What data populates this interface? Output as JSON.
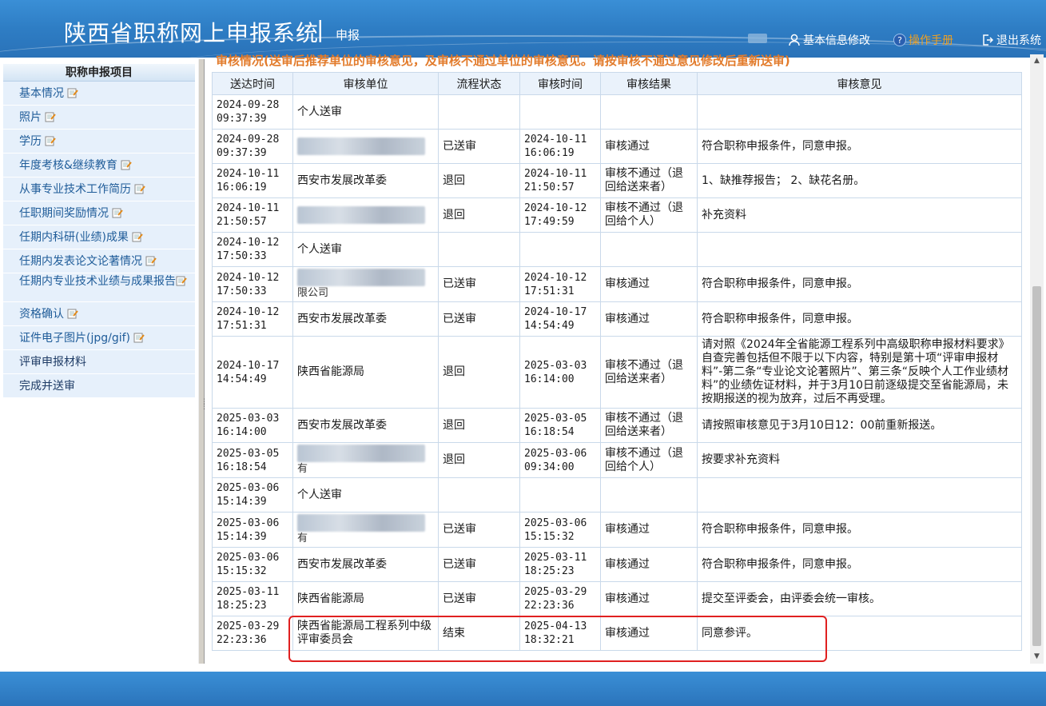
{
  "header": {
    "title": "陕西省职称网上申报系统",
    "separator": "|",
    "subtitle": "申报",
    "links": {
      "info": "基本信息修改",
      "manual": "操作手册",
      "exit": "退出系统"
    },
    "colors": {
      "bar": "#2e7dc4",
      "manual": "#f0a020"
    }
  },
  "sidebar": {
    "heading": "职称申报项目",
    "items": [
      {
        "label": "基本情况",
        "icon": "edit-icon"
      },
      {
        "label": "照片",
        "icon": "edit-icon"
      },
      {
        "label": "学历",
        "icon": "edit-icon"
      },
      {
        "label": "年度考核&继续教育",
        "icon": "edit-icon"
      },
      {
        "label": "从事专业技术工作简历",
        "icon": "edit-icon"
      },
      {
        "label": "任职期间奖励情况",
        "icon": "edit-icon"
      },
      {
        "label": "任期内科研(业绩)成果",
        "icon": "edit-icon"
      },
      {
        "label": "任期内发表论文论著情况",
        "icon": "edit-icon"
      },
      {
        "label": "任期内专业技术业绩与成果报告",
        "icon": "edit-icon"
      },
      {
        "label": "资格确认",
        "icon": "edit-icon"
      },
      {
        "label": "证件电子图片(jpg/gif)",
        "icon": "edit-icon"
      },
      {
        "label": "评审申报材料"
      },
      {
        "label": "完成并送审"
      }
    ]
  },
  "main": {
    "heading": "审核情况(送审后推荐单位的审核意见，及审核不通过单位的审核意见。请按审核不通过意见修改后重新送审)",
    "columns": [
      "送达时间",
      "审核单位",
      "流程状态",
      "审核时间",
      "审核结果",
      "审核意见"
    ],
    "rows": [
      {
        "sent": "2024-09-28 09:37:39",
        "unit": "个人送审",
        "status": "",
        "time": "",
        "result": "",
        "opinion": ""
      },
      {
        "sent": "2024-09-28 09:37:39",
        "unit": "",
        "unit_tail": "",
        "status": "已送审",
        "time": "2024-10-11 16:06:19",
        "result": "审核通过",
        "opinion": "符合职称申报条件，同意申报。"
      },
      {
        "sent": "2024-10-11 16:06:19",
        "unit": "西安市发展改革委",
        "status": "退回",
        "time": "2024-10-11 21:50:57",
        "result": "审核不通过（退回给送来者）",
        "opinion": "1、缺推荐报告； 2、缺花名册。"
      },
      {
        "sent": "2024-10-11 21:50:57",
        "unit": "",
        "unit_tail": "",
        "status": "退回",
        "time": "2024-10-12 17:49:59",
        "result": "审核不通过（退回给个人）",
        "opinion": "补充资料"
      },
      {
        "sent": "2024-10-12 17:50:33",
        "unit": "个人送审",
        "status": "",
        "time": "",
        "result": "",
        "opinion": ""
      },
      {
        "sent": "2024-10-12 17:50:33",
        "unit": "",
        "unit_tail": "限公司",
        "status": "已送审",
        "time": "2024-10-12 17:51:31",
        "result": "审核通过",
        "opinion": "符合职称申报条件，同意申报。"
      },
      {
        "sent": "2024-10-12 17:51:31",
        "unit": "西安市发展改革委",
        "status": "已送审",
        "time": "2024-10-17 14:54:49",
        "result": "审核通过",
        "opinion": "符合职称申报条件，同意申报。"
      },
      {
        "sent": "2024-10-17 14:54:49",
        "unit": "陕西省能源局",
        "status": "退回",
        "time": "2025-03-03 16:14:00",
        "result": "审核不通过（退回给送来者）",
        "opinion": "请对照《2024年全省能源工程系列中高级职称申报材料要求》自查完善包括但不限于以下内容，特别是第十项“评审申报材料”-第二条“专业论文论著照片”、第三条“反映个人工作业绩材料”的业绩佐证材料，并于3月10日前逐级提交至省能源局，未按期报送的视为放弃，过后不再受理。"
      },
      {
        "sent": "2025-03-03 16:14:00",
        "unit": "西安市发展改革委",
        "status": "退回",
        "time": "2025-03-05 16:18:54",
        "result": "审核不通过（退回给送来者）",
        "opinion": "请按照审核意见于3月10日12：00前重新报送。"
      },
      {
        "sent": "2025-03-05 16:18:54",
        "unit": "",
        "unit_tail": "有",
        "status": "退回",
        "time": "2025-03-06 09:34:00",
        "result": "审核不通过（退回给个人）",
        "opinion": "按要求补充资料"
      },
      {
        "sent": "2025-03-06 15:14:39",
        "unit": "个人送审",
        "status": "",
        "time": "",
        "result": "",
        "opinion": ""
      },
      {
        "sent": "2025-03-06 15:14:39",
        "unit": "",
        "unit_tail": "有",
        "status": "已送审",
        "time": "2025-03-06 15:15:32",
        "result": "审核通过",
        "opinion": "符合职称申报条件，同意申报。"
      },
      {
        "sent": "2025-03-06 15:15:32",
        "unit": "西安市发展改革委",
        "status": "已送审",
        "time": "2025-03-11 18:25:23",
        "result": "审核通过",
        "opinion": "符合职称申报条件，同意申报。"
      },
      {
        "sent": "2025-03-11 18:25:23",
        "unit": "陕西省能源局",
        "status": "已送审",
        "time": "2025-03-29 22:23:36",
        "result": "审核通过",
        "opinion": "提交至评委会，由评委会统一审核。"
      },
      {
        "sent": "2025-03-29 22:23:36",
        "unit": "陕西省能源局工程系列中级评审委员会",
        "status": "结束",
        "time": "2025-04-13 18:32:21",
        "result": "审核通过",
        "opinion": "同意参评。"
      }
    ],
    "highlight_color": "#e02020"
  }
}
